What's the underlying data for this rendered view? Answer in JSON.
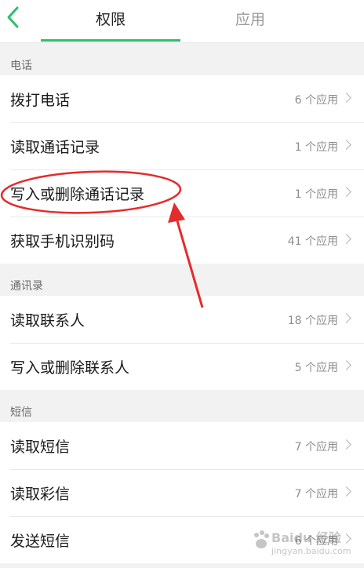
{
  "header": {
    "back_icon": "chevron-left-icon",
    "tabs": [
      {
        "label": "权限",
        "active": true
      },
      {
        "label": "应用",
        "active": false
      }
    ],
    "accent_color": "#2cbf6c"
  },
  "sections": [
    {
      "title": "电话",
      "items": [
        {
          "label": "拨打电话",
          "count": "6 个应用"
        },
        {
          "label": "读取通话记录",
          "count": "1 个应用"
        },
        {
          "label": "写入或删除通话记录",
          "count": "1 个应用"
        },
        {
          "label": "获取手机识别码",
          "count": "41 个应用"
        }
      ]
    },
    {
      "title": "通讯录",
      "items": [
        {
          "label": "读取联系人",
          "count": "18 个应用"
        },
        {
          "label": "写入或删除联系人",
          "count": "5 个应用"
        }
      ]
    },
    {
      "title": "短信",
      "items": [
        {
          "label": "读取短信",
          "count": "7 个应用"
        },
        {
          "label": "读取彩信",
          "count": "7 个应用"
        },
        {
          "label": "发送短信",
          "count": "6 个应用"
        }
      ]
    }
  ],
  "annotation": {
    "color": "#e52b2b"
  },
  "watermark": {
    "line1": "Baidu 经验",
    "line2": "jingyan.baidu.com"
  }
}
